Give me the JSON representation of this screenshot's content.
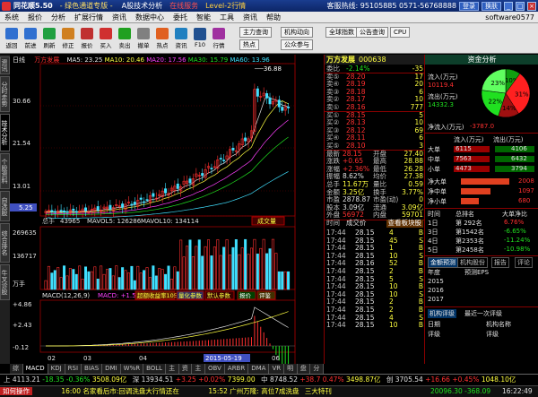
{
  "titlebar": {
    "app": "同花顺5.50",
    "channel": "- 绿色通道专版 -",
    "view": "A股技术分析",
    "ad": "在线服务",
    "level2": "Level-2行情",
    "hotline": "客服热线: 95105885 0571-56768888",
    "btn_login": "登录",
    "btn_skin": "换肤",
    "btn_min": "_",
    "btn_max": "□",
    "btn_close": "×"
  },
  "menu": {
    "items": [
      "系统",
      "报价",
      "分析",
      "扩展行情",
      "资讯",
      "数据中心",
      "委托",
      "智能",
      "工具",
      "资讯",
      "帮助"
    ],
    "software": "software0577"
  },
  "toolbar": {
    "icons": [
      "返回",
      "前进",
      "刷新",
      "修正",
      "报价",
      "买入",
      "卖出",
      "撤单",
      "热点",
      "资讯",
      "F10",
      "行情"
    ],
    "buttons_r1": [
      "主力查询",
      "机构动向",
      "全球指数",
      "公告查询",
      "CPU"
    ],
    "buttons_r2": [
      "热点",
      "公众参与"
    ]
  },
  "sidetabs": [
    "资讯",
    "分时走势",
    "技术分析",
    "个股资料",
    "自选股",
    "综合排名",
    "牛叉诊股"
  ],
  "kline_info": {
    "period": "日线",
    "name": "万方发展",
    "ma5": "MA5: 23.25",
    "ma10": "MA10: 20.46",
    "ma20": "MA20: 17.56",
    "ma30": "MA30: 15.79",
    "ma60": "MA60: 13.96"
  },
  "price_axis": [
    "30.66",
    "21.54",
    "13.01",
    "5.25"
  ],
  "high_label": "36.88",
  "low_label": "5.25",
  "volume_info": {
    "label": "总手",
    "vol": "43965",
    "mavol5": "MAVOL5: 126286",
    "mavol10": "MAVOL10: 134114",
    "axis": [
      "269635",
      "136717",
      "万手"
    ],
    "btn": "成交量"
  },
  "macd_info": {
    "label": "MACD(12,26,9)",
    "macd": "MACD: +1.54",
    "dif": "DIF: +2.86",
    "dea": "DEA: +2.09",
    "btn1": "超额收益率105%",
    "btn2": "量化参数",
    "btn3": "默认参数",
    "btn4": "报价",
    "btn5": "评鉴",
    "axis": [
      "+4.86",
      "+2.43",
      "-0.12"
    ]
  },
  "date_axis": [
    "02",
    "03",
    "04",
    "2015-05-19",
    "06"
  ],
  "stock": {
    "name": "万方发展",
    "code": "000638"
  },
  "orderbook": {
    "weibi": {
      "label": "委比",
      "value": "-2.14%",
      "qty": "-35"
    },
    "asks": [
      {
        "label": "卖⑤",
        "price": "28.20",
        "qty": "17"
      },
      {
        "label": "卖④",
        "price": "28.19",
        "qty": "20"
      },
      {
        "label": "卖③",
        "price": "28.18",
        "qty": "6"
      },
      {
        "label": "卖②",
        "price": "28.17",
        "qty": "10"
      },
      {
        "label": "卖①",
        "price": "28.16",
        "qty": "777"
      }
    ],
    "bids": [
      {
        "label": "买①",
        "price": "28.15",
        "qty": "5"
      },
      {
        "label": "买②",
        "price": "28.13",
        "qty": "10"
      },
      {
        "label": "买③",
        "price": "28.12",
        "qty": "69"
      },
      {
        "label": "买④",
        "price": "28.11",
        "qty": "6"
      },
      {
        "label": "买⑤",
        "price": "28.10",
        "qty": "3"
      }
    ]
  },
  "quote": [
    {
      "l": "最新",
      "v": "28.15",
      "l2": "开盘",
      "v2": "27.40",
      "c": "red",
      "c2": "red"
    },
    {
      "l": "涨跌",
      "v": "+0.65",
      "l2": "最高",
      "v2": "28.88",
      "c": "red",
      "c2": "red"
    },
    {
      "l": "涨幅",
      "v": "+2.36%",
      "l2": "最低",
      "v2": "26.28",
      "c": "red",
      "c2": "green"
    },
    {
      "l": "振幅",
      "v": "8.62%",
      "l2": "均价",
      "v2": "27.38",
      "c": "white",
      "c2": "red"
    },
    {
      "l": "总手",
      "v": "11.67万",
      "l2": "量比",
      "v2": "0.59",
      "c": "yellow",
      "c2": "yellow"
    },
    {
      "l": "金额",
      "v": "3.25亿",
      "l2": "换手",
      "v2": "3.77%",
      "c": "yellow",
      "c2": "yellow"
    },
    {
      "l": "市盈",
      "v": "2878.87",
      "l2": "市盈(动)",
      "v2": "0",
      "c": "white",
      "c2": "white"
    },
    {
      "l": "股本",
      "v": "3.09亿",
      "l2": "流通",
      "v2": "3.09亿",
      "c": "white",
      "c2": "yellow"
    },
    {
      "l": "外盘",
      "v": "56972",
      "l2": "内盘",
      "v2": "59701",
      "c": "red",
      "c2": "green"
    }
  ],
  "ticks_header": {
    "time": "时间",
    "price": "成交价",
    "vol": "",
    "btn": "查看板块股"
  },
  "ticks": [
    {
      "t": "17:44",
      "p": "28.15",
      "v": "4",
      "d": "B"
    },
    {
      "t": "17:44",
      "p": "28.15",
      "v": "45",
      "d": "S"
    },
    {
      "t": "17:44",
      "p": "28.15",
      "v": "1",
      "d": "B"
    },
    {
      "t": "17:44",
      "p": "28.15",
      "v": "10",
      "d": "S"
    },
    {
      "t": "17:44",
      "p": "28.16",
      "v": "52",
      "d": "B"
    },
    {
      "t": "17:44",
      "p": "28.15",
      "v": "2",
      "d": "B"
    },
    {
      "t": "17:44",
      "p": "28.15",
      "v": "5",
      "d": "S"
    },
    {
      "t": "17:44",
      "p": "28.15",
      "v": "10",
      "d": "B"
    },
    {
      "t": "17:44",
      "p": "28.15",
      "v": "10",
      "d": "S"
    },
    {
      "t": "17:44",
      "p": "28.15",
      "v": "2",
      "d": "B"
    },
    {
      "t": "17:44",
      "p": "28.15",
      "v": "2",
      "d": "B"
    },
    {
      "t": "17:44",
      "p": "28.15",
      "v": "4",
      "d": "S"
    },
    {
      "t": "17:44",
      "p": "28.15",
      "v": "10",
      "d": "B"
    }
  ],
  "capflow": {
    "title": "资金分析",
    "in_label": "流入(万元)",
    "in_value": "10119.4",
    "out_label": "流出(万元)",
    "out_value": "14332.3",
    "net_label": "净流入(万元)",
    "net_value": "-3787.0",
    "pie": [
      {
        "label": "10%",
        "value": 10,
        "color": "#10a010"
      },
      {
        "label": "31%",
        "value": 31,
        "color": "#ff2020"
      },
      {
        "label": "14%",
        "value": 14,
        "color": "#a01010"
      },
      {
        "label": "22%",
        "value": 22,
        "color": "#20e020"
      },
      {
        "label": "23%",
        "value": 23,
        "color": "#60ff60"
      }
    ],
    "table_h": [
      "",
      "流入(万元)",
      "流出(万元)"
    ],
    "table": [
      {
        "l": "大单",
        "in": "6115",
        "out": "4106"
      },
      {
        "l": "中单",
        "in": "7563",
        "out": "6432"
      },
      {
        "l": "小单",
        "in": "4473",
        "out": "3794"
      }
    ],
    "net_rows": [
      {
        "l": "净大单",
        "v": "2008",
        "c": "red",
        "frac": 0.9
      },
      {
        "l": "净中单",
        "v": "1097",
        "c": "red",
        "frac": 0.55
      },
      {
        "l": "净小单",
        "v": "680",
        "c": "red",
        "frac": 0.34
      }
    ],
    "rank_h": [
      "时间",
      "总排名",
      "大单净比"
    ],
    "rank": [
      {
        "t": "1日",
        "r": "第 292名",
        "p": "6.76%",
        "c": "red"
      },
      {
        "t": "3日",
        "r": "第1542名",
        "p": "-6.65%",
        "c": "green"
      },
      {
        "t": "4日",
        "r": "第2353名",
        "p": "-11.24%",
        "c": "green"
      },
      {
        "t": "5日",
        "r": "第2458名",
        "p": "-10.98%",
        "c": "green"
      }
    ],
    "tabs2": [
      "金额预测",
      "机构股份",
      "报告",
      "评论"
    ],
    "fc_h": [
      "年度",
      "预测EPS"
    ],
    "fc": [
      {
        "y": "2015",
        "v": ""
      },
      {
        "y": "2016",
        "v": ""
      },
      {
        "y": "2017",
        "v": ""
      }
    ],
    "inst_h": [
      "机构评级",
      "最近一次评级"
    ],
    "inst": [
      "日期",
      "评级",
      "机构名称",
      "评级"
    ]
  },
  "bottom_tabs": [
    "综合",
    "MACD",
    "KDJ",
    "RSI",
    "BIAS",
    "DMI",
    "W%R",
    "BOLL",
    "主力",
    "资金",
    "主力",
    "OBV",
    "ARBR",
    "DMA",
    "VR",
    "明细",
    "盘口",
    "分价"
  ],
  "ticker": {
    "a": "上 4113.21",
    "a_chg": "-18.35",
    "a_pct": "-0.36%",
    "a_amt": "3508.09亿",
    "b": "深 13934.51",
    "b_chg": "+3.25",
    "b_pct": "+0.02%",
    "b_amt": "7399.00",
    "c": "中 8748.52",
    "c_chg": "+38.7",
    "c_pct": "0.47%",
    "c_amt": "3498.87亿",
    "d": "创 3705.54",
    "d_chg": "+16.66",
    "d_pct": "+0.45%",
    "d_amt": "1048.10亿"
  },
  "status": {
    "left": "如何操作",
    "news1": "16:00 名家看后市:回调洗盘大行情还在",
    "news2": "15:52 广州万隆: 高位7成洗盘",
    "news3": "三大特刊",
    "right": "20096.30 -368.09",
    "time": "16:22:49"
  }
}
